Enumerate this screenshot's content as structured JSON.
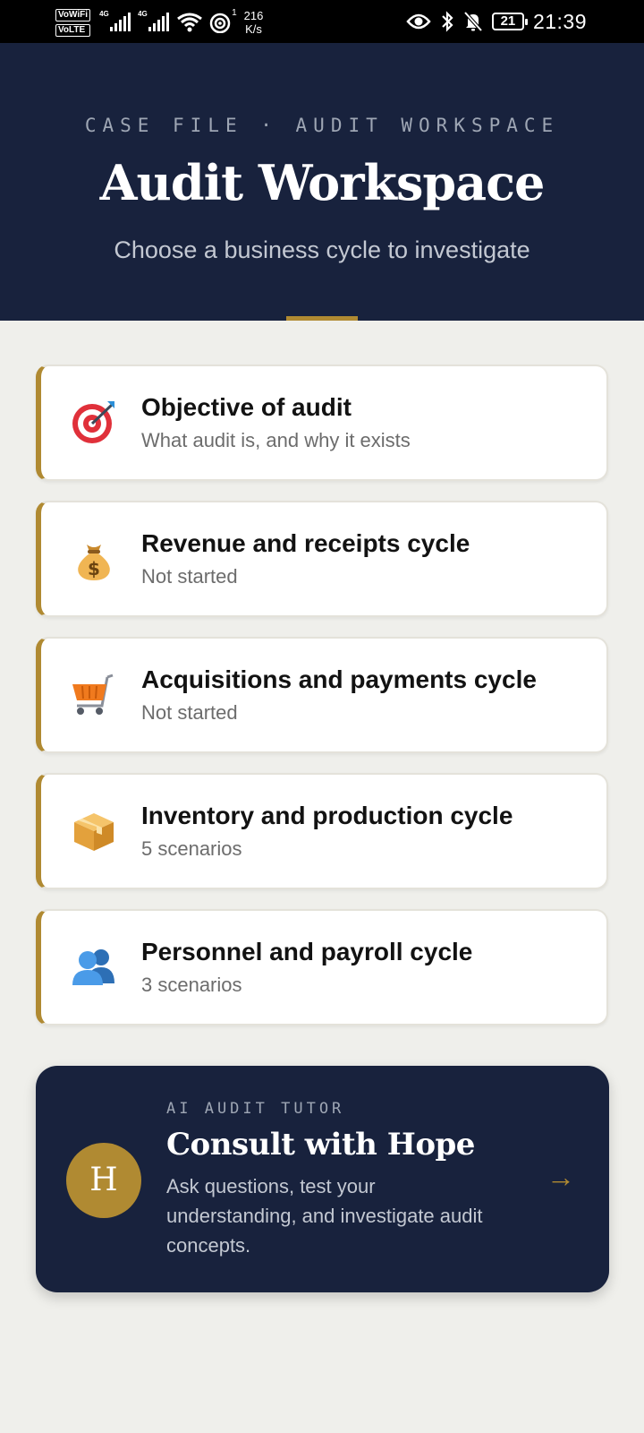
{
  "status_bar": {
    "vowifi": "VoWiFi",
    "volte": "VoLTE",
    "net1": "4G",
    "net2": "4G",
    "hotspot_count": "1",
    "speed_value": "216",
    "speed_unit": "K/s",
    "battery": "21",
    "time": "21:39"
  },
  "header": {
    "eyebrow": "CASE FILE · AUDIT WORKSPACE",
    "title": "Audit Workspace",
    "subtitle": "Choose a business cycle to investigate"
  },
  "cards": [
    {
      "title": "Objective of audit",
      "subtitle": "What audit is, and why it exists",
      "icon": "target-icon"
    },
    {
      "title": "Revenue and receipts cycle",
      "subtitle": "Not started",
      "icon": "money-bag-icon"
    },
    {
      "title": "Acquisitions and payments cycle",
      "subtitle": "Not started",
      "icon": "shopping-cart-icon"
    },
    {
      "title": "Inventory and production cycle",
      "subtitle": "5 scenarios",
      "icon": "package-icon"
    },
    {
      "title": "Personnel and payroll cycle",
      "subtitle": "3 scenarios",
      "icon": "people-icon"
    }
  ],
  "tutor": {
    "eyebrow": "AI AUDIT TUTOR",
    "title": "Consult with Hope",
    "description": "Ask questions, test your understanding, and investigate audit concepts.",
    "avatar_initial": "H",
    "arrow": "→"
  },
  "colors": {
    "navy": "#18223d",
    "gold": "#b08a32",
    "background": "#efefeb"
  }
}
